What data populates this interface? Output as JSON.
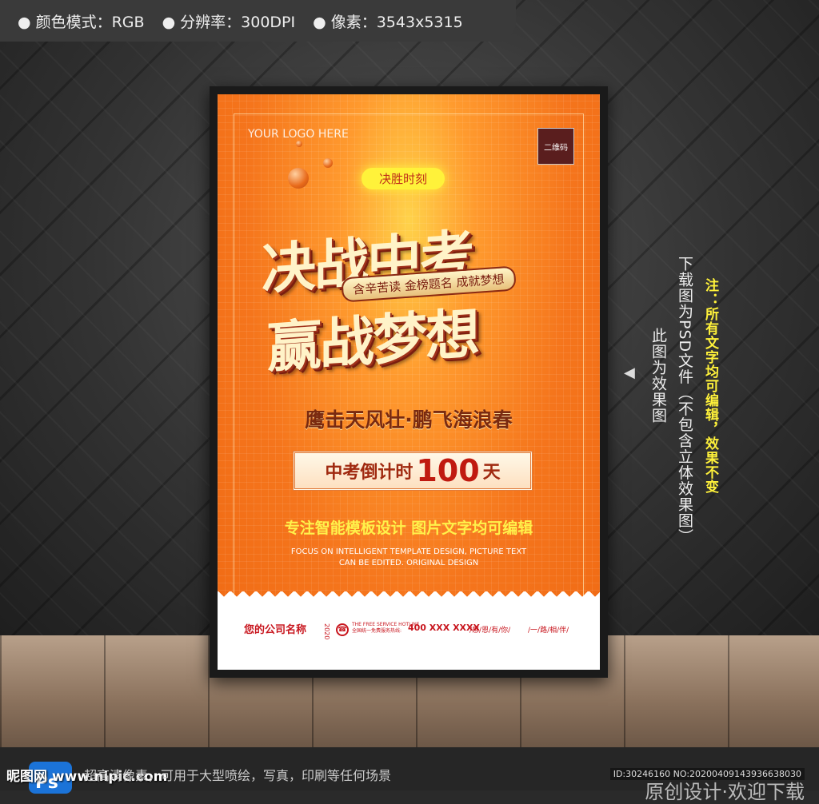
{
  "header": {
    "items": [
      "颜色模式：RGB",
      "分辨率：300DPI",
      "像素：3543x5315"
    ]
  },
  "poster": {
    "logo": "YOUR LOGO HERE",
    "qr": "二维码",
    "tag": "决胜时刻",
    "title_line1": "决战中考",
    "title_line2": "赢战梦想",
    "slogan": "含辛苦读 金榜题名 成就梦想",
    "subtitle": "鹰击天风壮·鹏飞海浪春",
    "countdown": {
      "prefix": "中考倒计时",
      "number": "100",
      "suffix": "天"
    },
    "description": "专注智能模板设计 图片文字均可编辑",
    "english": "FOCUS ON INTELLIGENT TEMPLATE DESIGN, PICTURE TEXT CAN BE EDITED. ORIGINAL DESIGN",
    "footer": {
      "company": "您的公司名称",
      "year": "2020",
      "hotline_en": "THE FREE SERVICE HOTLINE",
      "hotline_cn": "全国统一免费服务热线:",
      "phone": "400 XXX XXXX",
      "motto1": "/感/恩/有/你/",
      "motto2": "/一/路/相/伴/"
    }
  },
  "side": {
    "effect": "此图为效果图",
    "psd": "下载图为PSD文件（不包含立体效果图）",
    "note": "注：所有文字均可编辑，效果不变"
  },
  "bottom": {
    "site": "昵图网 www.nipic.com",
    "description": "超高清像素，可用于大型喷绘，写真，印刷等任何场景",
    "id": "ID:30246160 NO:20200409143936638030",
    "original": "原创设计·欢迎下载"
  },
  "colors": {
    "accent": "#f5751c",
    "note": "#fff23a",
    "red": "#c8161e"
  }
}
